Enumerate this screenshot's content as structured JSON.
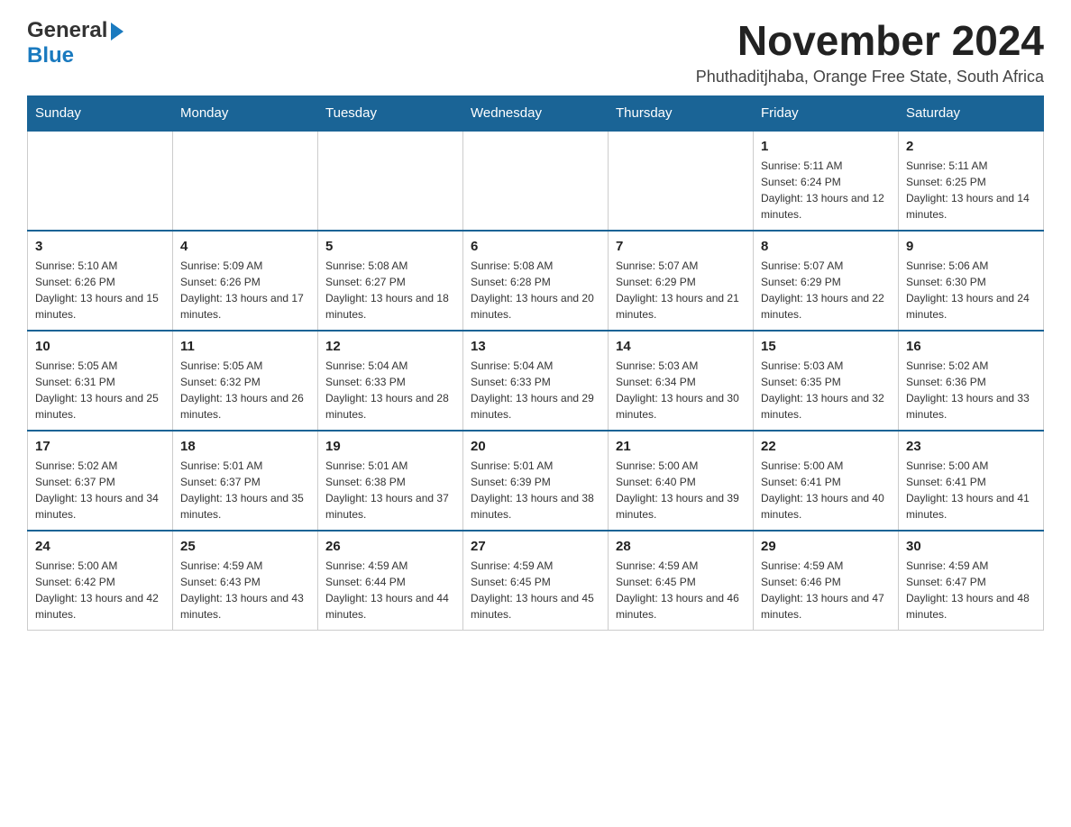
{
  "header": {
    "logo": {
      "general": "General",
      "blue": "Blue"
    },
    "month_title": "November 2024",
    "location": "Phuthaditjhaba, Orange Free State, South Africa"
  },
  "calendar": {
    "days_of_week": [
      "Sunday",
      "Monday",
      "Tuesday",
      "Wednesday",
      "Thursday",
      "Friday",
      "Saturday"
    ],
    "weeks": [
      [
        {
          "day": "",
          "info": ""
        },
        {
          "day": "",
          "info": ""
        },
        {
          "day": "",
          "info": ""
        },
        {
          "day": "",
          "info": ""
        },
        {
          "day": "",
          "info": ""
        },
        {
          "day": "1",
          "info": "Sunrise: 5:11 AM\nSunset: 6:24 PM\nDaylight: 13 hours and 12 minutes."
        },
        {
          "day": "2",
          "info": "Sunrise: 5:11 AM\nSunset: 6:25 PM\nDaylight: 13 hours and 14 minutes."
        }
      ],
      [
        {
          "day": "3",
          "info": "Sunrise: 5:10 AM\nSunset: 6:26 PM\nDaylight: 13 hours and 15 minutes."
        },
        {
          "day": "4",
          "info": "Sunrise: 5:09 AM\nSunset: 6:26 PM\nDaylight: 13 hours and 17 minutes."
        },
        {
          "day": "5",
          "info": "Sunrise: 5:08 AM\nSunset: 6:27 PM\nDaylight: 13 hours and 18 minutes."
        },
        {
          "day": "6",
          "info": "Sunrise: 5:08 AM\nSunset: 6:28 PM\nDaylight: 13 hours and 20 minutes."
        },
        {
          "day": "7",
          "info": "Sunrise: 5:07 AM\nSunset: 6:29 PM\nDaylight: 13 hours and 21 minutes."
        },
        {
          "day": "8",
          "info": "Sunrise: 5:07 AM\nSunset: 6:29 PM\nDaylight: 13 hours and 22 minutes."
        },
        {
          "day": "9",
          "info": "Sunrise: 5:06 AM\nSunset: 6:30 PM\nDaylight: 13 hours and 24 minutes."
        }
      ],
      [
        {
          "day": "10",
          "info": "Sunrise: 5:05 AM\nSunset: 6:31 PM\nDaylight: 13 hours and 25 minutes."
        },
        {
          "day": "11",
          "info": "Sunrise: 5:05 AM\nSunset: 6:32 PM\nDaylight: 13 hours and 26 minutes."
        },
        {
          "day": "12",
          "info": "Sunrise: 5:04 AM\nSunset: 6:33 PM\nDaylight: 13 hours and 28 minutes."
        },
        {
          "day": "13",
          "info": "Sunrise: 5:04 AM\nSunset: 6:33 PM\nDaylight: 13 hours and 29 minutes."
        },
        {
          "day": "14",
          "info": "Sunrise: 5:03 AM\nSunset: 6:34 PM\nDaylight: 13 hours and 30 minutes."
        },
        {
          "day": "15",
          "info": "Sunrise: 5:03 AM\nSunset: 6:35 PM\nDaylight: 13 hours and 32 minutes."
        },
        {
          "day": "16",
          "info": "Sunrise: 5:02 AM\nSunset: 6:36 PM\nDaylight: 13 hours and 33 minutes."
        }
      ],
      [
        {
          "day": "17",
          "info": "Sunrise: 5:02 AM\nSunset: 6:37 PM\nDaylight: 13 hours and 34 minutes."
        },
        {
          "day": "18",
          "info": "Sunrise: 5:01 AM\nSunset: 6:37 PM\nDaylight: 13 hours and 35 minutes."
        },
        {
          "day": "19",
          "info": "Sunrise: 5:01 AM\nSunset: 6:38 PM\nDaylight: 13 hours and 37 minutes."
        },
        {
          "day": "20",
          "info": "Sunrise: 5:01 AM\nSunset: 6:39 PM\nDaylight: 13 hours and 38 minutes."
        },
        {
          "day": "21",
          "info": "Sunrise: 5:00 AM\nSunset: 6:40 PM\nDaylight: 13 hours and 39 minutes."
        },
        {
          "day": "22",
          "info": "Sunrise: 5:00 AM\nSunset: 6:41 PM\nDaylight: 13 hours and 40 minutes."
        },
        {
          "day": "23",
          "info": "Sunrise: 5:00 AM\nSunset: 6:41 PM\nDaylight: 13 hours and 41 minutes."
        }
      ],
      [
        {
          "day": "24",
          "info": "Sunrise: 5:00 AM\nSunset: 6:42 PM\nDaylight: 13 hours and 42 minutes."
        },
        {
          "day": "25",
          "info": "Sunrise: 4:59 AM\nSunset: 6:43 PM\nDaylight: 13 hours and 43 minutes."
        },
        {
          "day": "26",
          "info": "Sunrise: 4:59 AM\nSunset: 6:44 PM\nDaylight: 13 hours and 44 minutes."
        },
        {
          "day": "27",
          "info": "Sunrise: 4:59 AM\nSunset: 6:45 PM\nDaylight: 13 hours and 45 minutes."
        },
        {
          "day": "28",
          "info": "Sunrise: 4:59 AM\nSunset: 6:45 PM\nDaylight: 13 hours and 46 minutes."
        },
        {
          "day": "29",
          "info": "Sunrise: 4:59 AM\nSunset: 6:46 PM\nDaylight: 13 hours and 47 minutes."
        },
        {
          "day": "30",
          "info": "Sunrise: 4:59 AM\nSunset: 6:47 PM\nDaylight: 13 hours and 48 minutes."
        }
      ]
    ]
  }
}
